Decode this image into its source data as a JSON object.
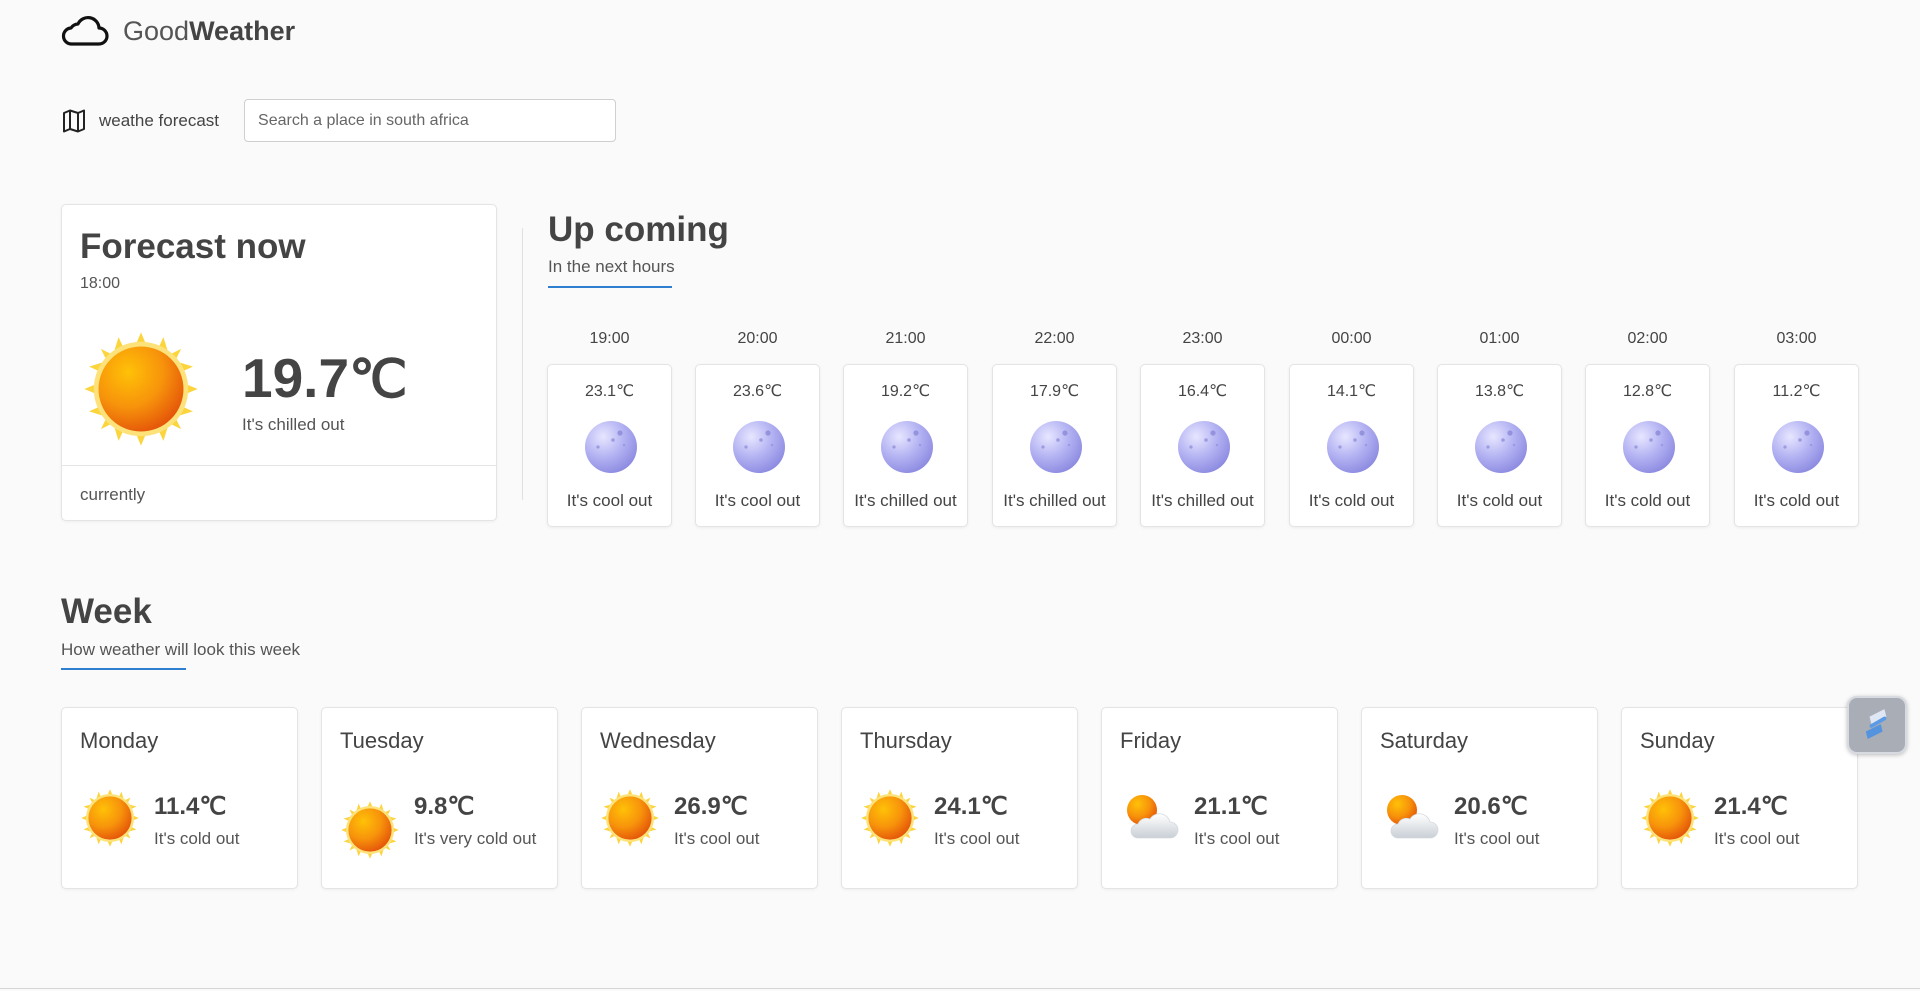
{
  "brand": {
    "name_light": "Good",
    "name_bold": "Weather"
  },
  "search": {
    "label": "weathe forecast",
    "placeholder": "Search a place in south africa"
  },
  "now": {
    "title": "Forecast now",
    "time": "18:00",
    "temp": "19.7",
    "unit": "℃",
    "desc": "It's chilled out",
    "footer": "currently"
  },
  "upcoming": {
    "title": "Up coming",
    "subtitle": "In the next hours",
    "hours": [
      {
        "time": "19:00",
        "temp": "23.1℃",
        "desc": "It's cool out"
      },
      {
        "time": "20:00",
        "temp": "23.6℃",
        "desc": "It's cool out"
      },
      {
        "time": "21:00",
        "temp": "19.2℃",
        "desc": "It's chilled out"
      },
      {
        "time": "22:00",
        "temp": "17.9℃",
        "desc": "It's chilled out"
      },
      {
        "time": "23:00",
        "temp": "16.4℃",
        "desc": "It's chilled out"
      },
      {
        "time": "00:00",
        "temp": "14.1℃",
        "desc": "It's cold out"
      },
      {
        "time": "01:00",
        "temp": "13.8℃",
        "desc": "It's cold out"
      },
      {
        "time": "02:00",
        "temp": "12.8℃",
        "desc": "It's cold out"
      },
      {
        "time": "03:00",
        "temp": "11.2℃",
        "desc": "It's cold out"
      }
    ]
  },
  "week": {
    "title": "Week",
    "subtitle": "How weather will look this week",
    "days": [
      {
        "name": "Monday",
        "temp": "11.4",
        "unit": "℃",
        "desc": "It's cold out",
        "icon": "sun-icon"
      },
      {
        "name": "Tuesday",
        "temp": "9.8",
        "unit": "℃",
        "desc": "It's very cold out",
        "icon": "sun-icon"
      },
      {
        "name": "Wednesday",
        "temp": "26.9",
        "unit": "℃",
        "desc": "It's cool out",
        "icon": "sun-icon"
      },
      {
        "name": "Thursday",
        "temp": "24.1",
        "unit": "℃",
        "desc": "It's cool out",
        "icon": "sun-icon"
      },
      {
        "name": "Friday",
        "temp": "21.1",
        "unit": "℃",
        "desc": "It's cool out",
        "icon": "partly-cloudy-icon"
      },
      {
        "name": "Saturday",
        "temp": "20.6",
        "unit": "℃",
        "desc": "It's cool out",
        "icon": "partly-cloudy-icon"
      },
      {
        "name": "Sunday",
        "temp": "21.4",
        "unit": "℃",
        "desc": "It's cool out",
        "icon": "sun-icon"
      }
    ]
  },
  "colors": {
    "accent": "#2f7fd1",
    "sun_outer": "#f9d423",
    "sun_inner": "#e65c00",
    "moon": "#8c8ee8"
  }
}
